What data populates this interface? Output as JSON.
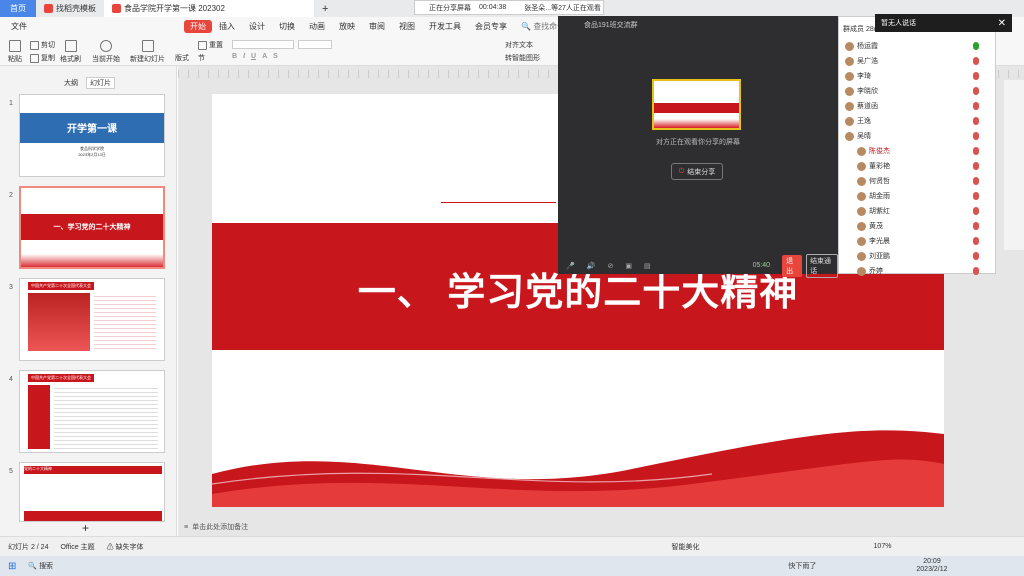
{
  "tabs": {
    "home": "首页",
    "template": "找稻壳模板",
    "doc": "食品学院开学第一课 202302",
    "add": "+"
  },
  "share_bar": {
    "status": "正在分享屏幕",
    "timer": "00:04:38",
    "watchers": "张圣朵...等27人正在观看"
  },
  "menus": [
    "文件",
    "开始",
    "插入",
    "设计",
    "切换",
    "动画",
    "放映",
    "审阅",
    "视图",
    "开发工具",
    "会员专享"
  ],
  "search_placeholder": "查找命令、搜索模板",
  "ribbon": {
    "paste": "粘贴",
    "cut": "剪切",
    "copy": "复制",
    "format": "格式刷",
    "current": "当前开始",
    "new_slide": "新建幻灯片",
    "layout": "版式",
    "section": "节",
    "reset": "重置",
    "align_text": "对齐文本",
    "convert": "转智能图形"
  },
  "left_tabs": {
    "outline": "大纲",
    "slides": "幻灯片"
  },
  "thumbs": [
    {
      "num": "1",
      "title": "开学第一课",
      "sub1": "食品科学学院",
      "sub2": "2023年2月13日"
    },
    {
      "num": "2",
      "title": "一、学习党的二十大精神"
    },
    {
      "num": "3",
      "title": "中国共产党第二十次全国代表大会"
    },
    {
      "num": "4",
      "title": "中国共产党第二十次全国代表大会"
    },
    {
      "num": "5",
      "title": "党的二十大精神"
    }
  ],
  "slide": {
    "title": "一、 学习党的二十大精神"
  },
  "notes": "单击此处添加备注",
  "status": {
    "slide_count": "幻灯片 2 / 24",
    "theme": "Office 主题",
    "font": "缺失字体",
    "beautify": "智能美化",
    "zoom": "107%"
  },
  "meeting": {
    "group": "食品191班交流群",
    "hint": "对方正在观看你分享的屏幕",
    "end_share": "结束分享",
    "timer": "05:40",
    "leave": "退出",
    "end": "结束通话",
    "members_title": "群成员 28/45",
    "muted_toast": "暂无人说话"
  },
  "member_list": [
    "杨运霞",
    "吴广浩",
    "李琦",
    "李晓欣",
    "蔡道函",
    "王逸",
    "吴晴",
    "陈俊杰",
    "董彩艳",
    "何贤哲",
    "胡金雨",
    "胡紫红",
    "黄茂",
    "李光晨",
    "刘亚鹏",
    "乔婷"
  ],
  "taskbar": {
    "search": "搜索",
    "weather": "快下雨了",
    "time": "20:09",
    "date": "2023/2/12"
  },
  "colors": {
    "accent": "#c8161d",
    "share_bg": "#2e2e30",
    "start": "#e8453c"
  }
}
